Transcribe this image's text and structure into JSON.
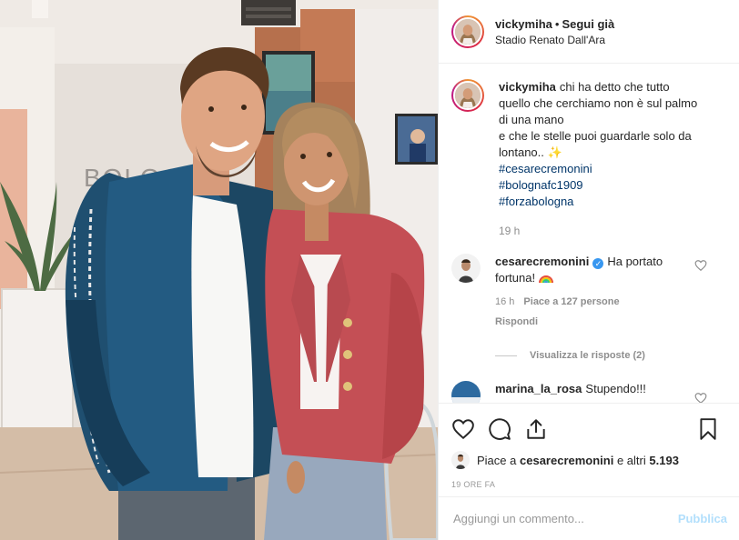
{
  "post": {
    "username": "vickymiha",
    "follow_label": "Segui già",
    "location": "Stadio Renato Dall'Ara",
    "caption_lines": [
      "chi ha detto che tutto",
      "quello che cerchiamo non è sul palmo",
      "di una mano",
      "e che le stelle puoi guardarle solo da",
      "lontano.. ✨"
    ],
    "hashtags": [
      "#cesarecremonini",
      "#bolognafc1909",
      "#forzabologna"
    ],
    "time": "19 h",
    "photo_wall_text": "BOLOGNA"
  },
  "comments": [
    {
      "username": "cesarecremonini",
      "text_line1": "Ha portato",
      "text_line2": "fortuna!",
      "time": "16 h",
      "likes": "Piace a 127 persone",
      "reply_label": "Rispondi",
      "view_replies": "Visualizza le risposte (2)"
    },
    {
      "username": "marina_la_rosa",
      "text": "Stupendo!!!"
    }
  ],
  "likes_line": {
    "prefix": "Piace a",
    "user": "cesarecremonini",
    "suffix": "e altri",
    "count": "5.193"
  },
  "posted_ago": "19 ORE FA",
  "add_comment": {
    "placeholder": "Aggiungi un commento...",
    "publish_label": "Pubblica"
  },
  "icons": {
    "like": "heart-icon",
    "comment": "comment-icon",
    "share": "share-icon",
    "save": "bookmark-icon",
    "verified": "verified-badge-icon"
  },
  "colors": {
    "link": "#003569",
    "muted": "#8e8e8e",
    "publish_disabled": "#b2dffc",
    "verified": "#3897f0"
  }
}
